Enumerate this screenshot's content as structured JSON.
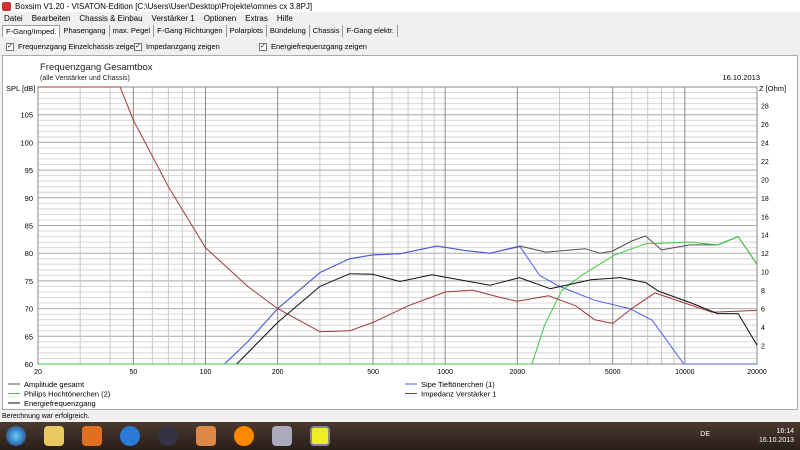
{
  "window": {
    "title": "Boxsim V1.20 - VISATON-Edition [C:\\Users\\User\\Desktop\\Projekte\\omnes cx 3.8PJ]"
  },
  "menu": [
    "Datei",
    "Bearbeiten",
    "Chassis & Einbau",
    "Verstärker 1",
    "Optionen",
    "Extras",
    "Hilfe"
  ],
  "tabs": [
    "F-Gang/Imped.",
    "Phasengang",
    "max. Pegel",
    "F-Gang Richtungen",
    "Polarplots",
    "Bündelung",
    "Chassis",
    "F-Gang elektr."
  ],
  "checkboxes": [
    {
      "label": "Frequenzgang Einzelchassis zeigen",
      "checked": true
    },
    {
      "label": "Impedanzgang zeigen",
      "checked": true
    },
    {
      "label": "Energiefrequenzgang zeigen",
      "checked": true
    }
  ],
  "status": "Berechnung war erfolgreich.",
  "taskbar": {
    "lang": "DE",
    "time": "16:14",
    "date": "16.10.2013"
  },
  "chart_data": {
    "type": "line",
    "title": "Frequenzgang Gesamtbox",
    "subtitle": "(alle Verstärker und Chassis)",
    "date": "16.10.2013",
    "ylabel": "SPL [dB]",
    "y2label": "Z [Ohm]",
    "xlim": [
      20,
      20000
    ],
    "ylim": [
      60,
      110
    ],
    "y2lim": [
      0,
      30
    ],
    "xscale": "log",
    "grid": true,
    "xticks": [
      20,
      50,
      100,
      200,
      500,
      1000,
      2000,
      5000,
      10000,
      20000
    ],
    "yticks": [
      60,
      65,
      70,
      75,
      80,
      85,
      90,
      95,
      100,
      105
    ],
    "y2ticks": [
      2,
      4,
      6,
      8,
      10,
      12,
      14,
      16,
      18,
      20,
      22,
      24,
      26,
      28
    ],
    "series": [
      {
        "name": "Amplitude gesamt",
        "color": "#505050",
        "axis": "y",
        "x": [
          120,
          150,
          200,
          300,
          400,
          500,
          647,
          925,
          1200,
          1538,
          2050,
          2630,
          3850,
          4420,
          5000,
          6000,
          6850,
          8000,
          10500,
          13700,
          16700,
          20000
        ],
        "y": [
          60,
          64,
          70,
          76.5,
          79,
          79.7,
          79.9,
          81.3,
          80.5,
          80,
          81.3,
          80.2,
          80.8,
          80,
          80.4,
          82.2,
          83.1,
          80.6,
          81.5,
          81.5,
          83,
          78
        ]
      },
      {
        "name": "Sipe Tieftönerchen (1)",
        "color": "#4a5ce8",
        "axis": "y",
        "x": [
          120,
          150,
          200,
          300,
          400,
          500,
          647,
          925,
          1200,
          1538,
          2050,
          2480,
          3000,
          4210,
          5900,
          7300,
          9900,
          20000
        ],
        "y": [
          60,
          64,
          70,
          76.5,
          79,
          79.7,
          79.9,
          81.3,
          80.5,
          80,
          81.2,
          76,
          74,
          71.5,
          70,
          67.9,
          60,
          60
        ]
      },
      {
        "name": "Philips Hochtönerchen (2)",
        "color": "#3ccc3c",
        "axis": "y",
        "x": [
          20,
          2300,
          2600,
          3070,
          3700,
          5100,
          6850,
          10500,
          13700,
          16700,
          20000
        ],
        "y": [
          60,
          60,
          67,
          73.3,
          76,
          79.7,
          81.7,
          82,
          81.5,
          83,
          78
        ]
      },
      {
        "name": "Impedanz Verstärker 1",
        "color": "#a03838",
        "axis": "y2",
        "x": [
          20,
          44,
          50,
          70,
          100,
          150,
          200,
          300,
          400,
          500,
          700,
          1000,
          1300,
          1700,
          2000,
          2700,
          3500,
          4200,
          5000,
          6000,
          7500,
          10000,
          13000,
          20000
        ],
        "y": [
          30,
          30,
          26.4,
          19.2,
          12.6,
          8.4,
          6,
          3.5,
          3.6,
          4.5,
          6.3,
          7.8,
          8,
          7.2,
          6.8,
          7.4,
          6.3,
          4.8,
          4.4,
          6,
          7.7,
          6.6,
          5.6,
          5.8
        ]
      },
      {
        "name": "Energiefrequenzgang",
        "color": "#101010",
        "axis": "y",
        "x": [
          135,
          200,
          300,
          400,
          500,
          647,
          880,
          1540,
          2040,
          2740,
          4050,
          5400,
          6850,
          7800,
          10500,
          13700,
          16700,
          20000
        ],
        "y": [
          60,
          67.5,
          74,
          76.3,
          76.2,
          74.9,
          76.1,
          74.2,
          75.6,
          73.6,
          75.2,
          75.6,
          74.7,
          73.1,
          71.1,
          69.1,
          69.1,
          63.4
        ]
      }
    ]
  }
}
